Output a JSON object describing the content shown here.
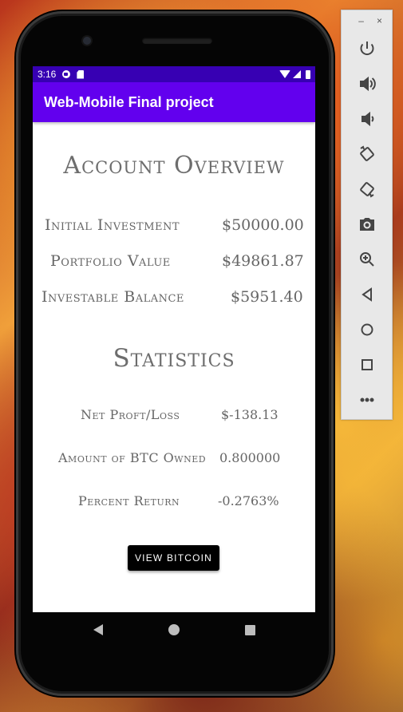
{
  "status_bar": {
    "time": "3:16"
  },
  "app_bar": {
    "title": "Web-Mobile Final project"
  },
  "account": {
    "title": "Account Overview",
    "rows": [
      {
        "label": "Initial Investment",
        "value": "$50000.00"
      },
      {
        "label": "Portfolio Value",
        "value": "$49861.87"
      },
      {
        "label": "Investable Balance",
        "value": "$5951.40"
      }
    ]
  },
  "statistics": {
    "title": "Statistics",
    "rows": [
      {
        "label": "Net Proft/Loss",
        "value": "$-138.13"
      },
      {
        "label": "Amount of BTC Owned",
        "value": "0.800000"
      },
      {
        "label": "Percent Return",
        "value": "-0.2763%"
      }
    ]
  },
  "button": {
    "label": "VIEW BITCOIN"
  },
  "emulator_toolbar": {
    "minimize": "–",
    "close": "×",
    "buttons": [
      "power-icon",
      "volume-up-icon",
      "volume-down-icon",
      "rotate-left-icon",
      "rotate-right-icon",
      "camera-icon",
      "zoom-icon",
      "back-icon",
      "home-icon",
      "overview-icon",
      "more-icon"
    ]
  },
  "colors": {
    "status_bar": "#3700b3",
    "app_bar": "#6200ee",
    "button": "#000000",
    "text": "#666666"
  }
}
